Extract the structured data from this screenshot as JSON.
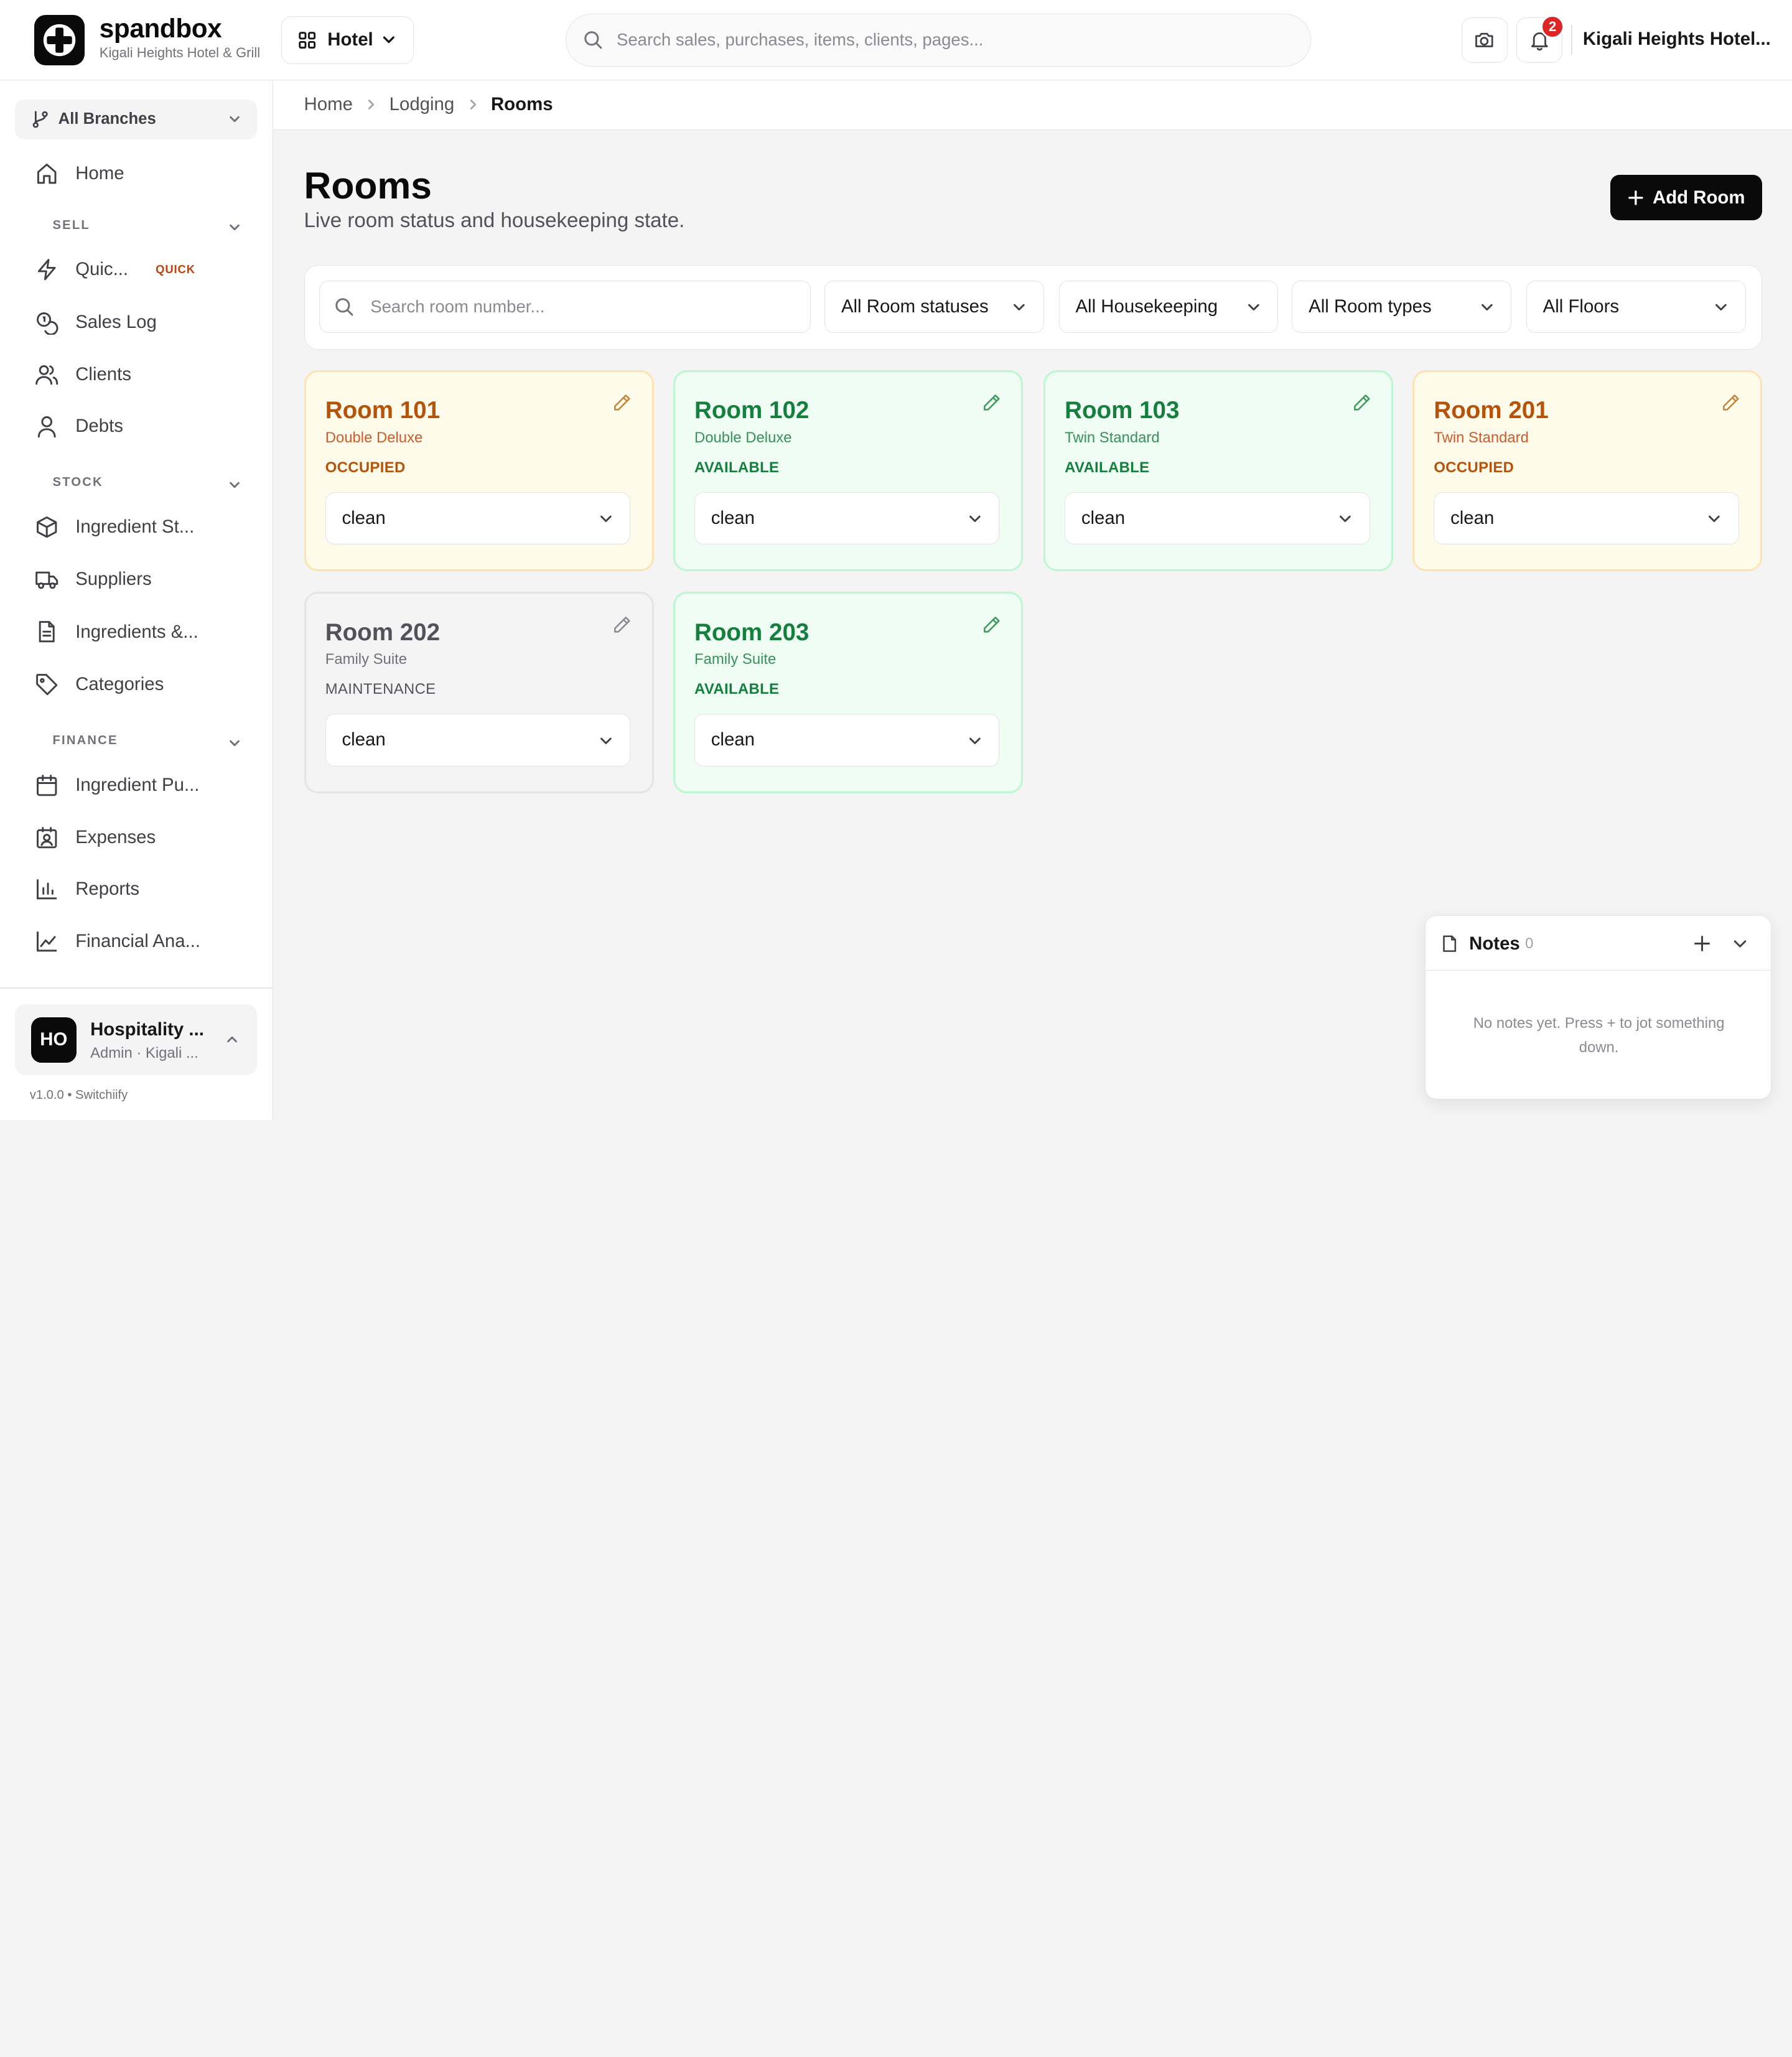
{
  "brand": {
    "name": "spandbox",
    "subtitle": "Kigali Heights Hotel & Grill"
  },
  "header": {
    "module": "Hotel",
    "search_placeholder": "Search sales, purchases, items, clients, pages...",
    "notification_count": "2",
    "account_name": "Kigali Heights Hotel..."
  },
  "sidebar": {
    "branch": "All Branches",
    "home": "Home",
    "sections": {
      "sell": "SELL",
      "stock": "STOCK",
      "finance": "FINANCE"
    },
    "items": {
      "quick": "Quic...",
      "quick_tag": "QUICK",
      "sales_log": "Sales Log",
      "clients": "Clients",
      "debts": "Debts",
      "ingredient_stock": "Ingredient St...",
      "suppliers": "Suppliers",
      "ingredients": "Ingredients &...",
      "categories": "Categories",
      "ingredient_purchases": "Ingredient Pu...",
      "expenses": "Expenses",
      "reports": "Reports",
      "financial_analysis": "Financial Ana..."
    },
    "user": {
      "initials": "HO",
      "name": "Hospitality ...",
      "role": "Admin · Kigali ..."
    },
    "version": "v1.0.0 • Switchiify"
  },
  "breadcrumb": [
    "Home",
    "Lodging",
    "Rooms"
  ],
  "page": {
    "title": "Rooms",
    "subtitle": "Live room status and housekeeping state.",
    "add_button": "Add Room"
  },
  "filters": {
    "search_placeholder": "Search room number...",
    "status": "All Room statuses",
    "housekeeping": "All Housekeeping",
    "room_type": "All Room types",
    "floor": "All Floors"
  },
  "rooms": [
    {
      "name": "Room 101",
      "type": "Double Deluxe",
      "status": "OCCUPIED",
      "housekeeping": "clean"
    },
    {
      "name": "Room 102",
      "type": "Double Deluxe",
      "status": "AVAILABLE",
      "housekeeping": "clean"
    },
    {
      "name": "Room 103",
      "type": "Twin Standard",
      "status": "AVAILABLE",
      "housekeeping": "clean"
    },
    {
      "name": "Room 201",
      "type": "Twin Standard",
      "status": "OCCUPIED",
      "housekeeping": "clean"
    },
    {
      "name": "Room 202",
      "type": "Family Suite",
      "status": "MAINTENANCE",
      "housekeeping": "clean"
    },
    {
      "name": "Room 203",
      "type": "Family Suite",
      "status": "AVAILABLE",
      "housekeeping": "clean"
    }
  ],
  "notes": {
    "title": "Notes",
    "count": "0",
    "empty_text": "No notes yet. Press + to jot something down."
  },
  "colors": {
    "occupied": "#b45309",
    "available": "#15803d",
    "maintenance": "#52525b",
    "badge": "#dc2626",
    "primary": "#0a0a0a"
  }
}
